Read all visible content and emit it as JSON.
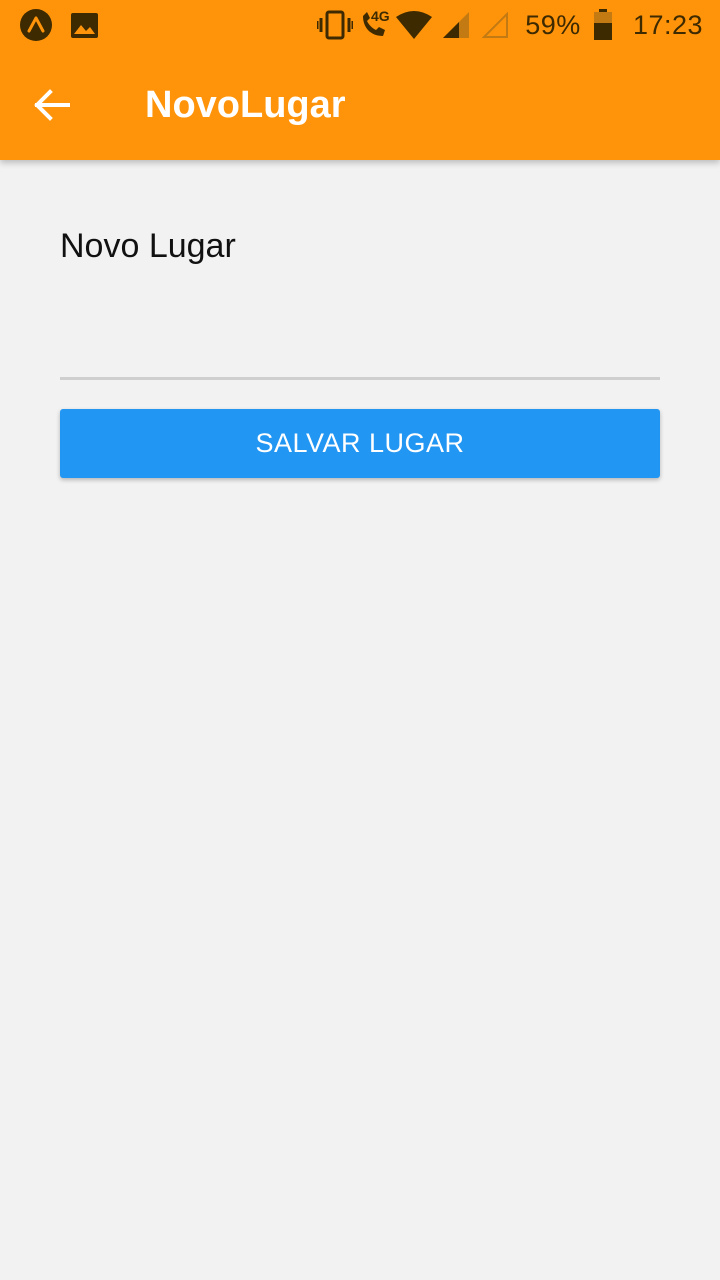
{
  "status_bar": {
    "icons": [
      "expo-notification-icon",
      "image-notification-icon",
      "vibrate-icon",
      "wifi-call-icon",
      "wifi-icon",
      "cell-signal-icon",
      "cell-signal-empty-icon",
      "battery-icon"
    ],
    "network_label": "4G",
    "battery_percent": "59%",
    "battery_level": 0.59,
    "time": "17:23"
  },
  "app_bar": {
    "title": "NovoLugar",
    "back_icon": "back-arrow-icon",
    "background_color": "#ff940b"
  },
  "form": {
    "label": "Novo Lugar",
    "input_value": "",
    "input_placeholder": "",
    "save_button_label": "SALVAR LUGAR",
    "save_button_color": "#2196f3"
  }
}
